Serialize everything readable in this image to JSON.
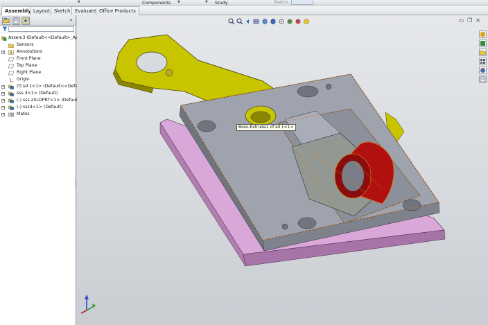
{
  "top_strip": {
    "components": "Components",
    "study": "Study",
    "sketch": "Sketch"
  },
  "tabs": [
    {
      "label": "Assembly",
      "active": true
    },
    {
      "label": "Layout",
      "active": false
    },
    {
      "label": "Sketch",
      "active": false
    },
    {
      "label": "Evaluate",
      "active": false
    },
    {
      "label": "Office Products",
      "active": false
    }
  ],
  "tree": {
    "root": "Assem3  (Default<<Default>_Appe",
    "items": [
      {
        "label": "Sensors",
        "icon": "sensors-folder-icon",
        "expander": ""
      },
      {
        "label": "Annotations",
        "icon": "annotations-icon",
        "expander": "+"
      },
      {
        "label": "Front Plane",
        "icon": "plane-icon",
        "expander": ""
      },
      {
        "label": "Top Plane",
        "icon": "plane-icon",
        "expander": ""
      },
      {
        "label": "Right Plane",
        "icon": "plane-icon",
        "expander": ""
      },
      {
        "label": "Origin",
        "icon": "origin-icon",
        "expander": ""
      },
      {
        "label": "(f) sd 1<1> (Default<<Default",
        "icon": "part-icon",
        "expander": "+"
      },
      {
        "label": "sss.3<1> (Default)",
        "icon": "part-icon",
        "expander": "+"
      },
      {
        "label": "(-) sss.2SLDPRT<1> (Default<",
        "icon": "part-icon",
        "expander": "+"
      },
      {
        "label": "(-) sss4<1> (Default)",
        "icon": "part-icon",
        "expander": "+"
      },
      {
        "label": "Mates",
        "icon": "mates-icon",
        "expander": "+"
      }
    ]
  },
  "tooltip": "Boss-Extrude1 of sd 1<1>",
  "colors": {
    "accent_blue": "#2f6fbf",
    "plate_purple": "#d9a8d8",
    "part_gray": "#9ea3ad",
    "bracket_yellow": "#c8c400",
    "highlight_red": "#b01010",
    "selection_orange": "#e07a10"
  }
}
